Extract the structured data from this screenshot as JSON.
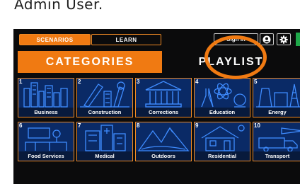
{
  "caption": "Admin User.",
  "topbar": {
    "scenarios_label": "SCENARIOS",
    "learn_label": "LEARN",
    "signin_label": "Sign In",
    "user_icon": "user-circle-icon",
    "gear_icon": "gear-icon"
  },
  "tabs": {
    "categories_label": "CATEGORIES",
    "playlist_label": "PLAYLIST"
  },
  "categories": [
    {
      "num": "1",
      "label": "Business",
      "icon": "city-skyline-icon"
    },
    {
      "num": "2",
      "label": "Construction",
      "icon": "construction-tools-icon"
    },
    {
      "num": "3",
      "label": "Corrections",
      "icon": "courthouse-icon"
    },
    {
      "num": "4",
      "label": "Education",
      "icon": "science-icon"
    },
    {
      "num": "5",
      "label": "Energy",
      "icon": "power-plant-icon"
    },
    {
      "num": "6",
      "label": "Food Services",
      "icon": "restaurant-icon"
    },
    {
      "num": "7",
      "label": "Medical",
      "icon": "hospital-icon"
    },
    {
      "num": "8",
      "label": "Outdoors",
      "icon": "mountains-icon"
    },
    {
      "num": "9",
      "label": "Residential",
      "icon": "house-icon"
    },
    {
      "num": "10",
      "label": "Transport",
      "icon": "truck-plane-icon"
    }
  ],
  "colors": {
    "accent": "#f07a12",
    "tile_bg": "#0a2a66",
    "tile_art": "#3f8cff",
    "annotation_circle": "#f07a12"
  }
}
